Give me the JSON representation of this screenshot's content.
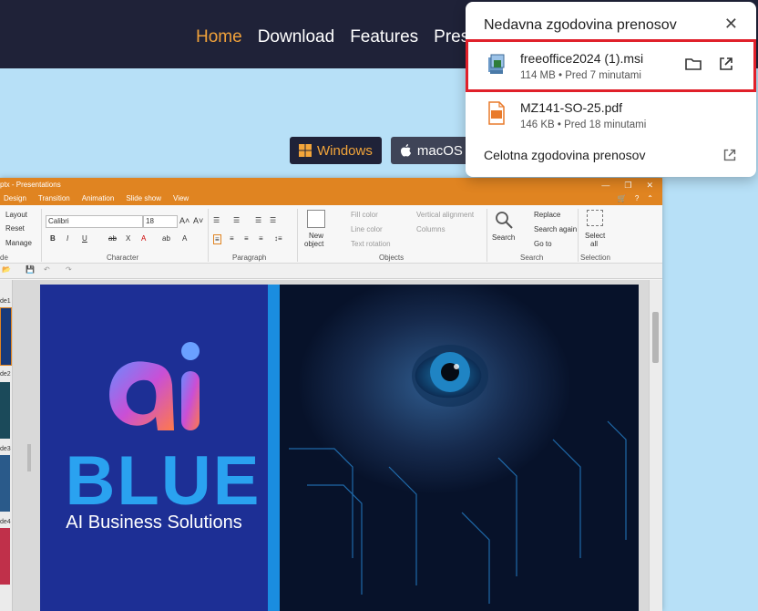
{
  "nav": {
    "links": [
      "Home",
      "Download",
      "Features",
      "Press"
    ],
    "active_color": "#f0a13a"
  },
  "os_buttons": {
    "windows": "Windows",
    "mac": "macOS"
  },
  "app": {
    "title": "ptx - Presentations",
    "tabs": [
      "Design",
      "Transition",
      "Animation",
      "Slide show",
      "View"
    ],
    "ribbon": {
      "layout": "Layout",
      "reset": "Reset",
      "manage": "Manage",
      "font_name": "Calibri",
      "font_size": "18",
      "new_object_1": "New",
      "new_object_2": "object",
      "fill_color": "Fill color",
      "line_color": "Line color",
      "text_rotation": "Text rotation",
      "vertical_alignment": "Vertical alignment",
      "columns": "Columns",
      "search": "Search",
      "replace": "Replace",
      "search_again": "Search again",
      "go_to": "Go to",
      "select_all_1": "Select",
      "select_all_2": "all",
      "groups": {
        "slide": "de",
        "character": "Character",
        "paragraph": "Paragraph",
        "objects": "Objects",
        "search": "Search",
        "selection": "Selection"
      }
    },
    "thumb_labels": [
      "de1",
      "de2",
      "de3",
      "de4"
    ],
    "slide": {
      "logo_text": "ai",
      "title": "BLUE",
      "subtitle": "AI Business Solutions"
    }
  },
  "downloads": {
    "title": "Nedavna zgodovina prenosov",
    "items": [
      {
        "name": "freeoffice2024 (1).msi",
        "meta": "114 MB • Pred 7 minutami",
        "highlighted": true
      },
      {
        "name": "MZ141-SO-25.pdf",
        "meta": "146 KB • Pred 18 minutami",
        "highlighted": false
      }
    ],
    "footer": "Celotna zgodovina prenosov",
    "highlight_color": "#e0202a"
  }
}
